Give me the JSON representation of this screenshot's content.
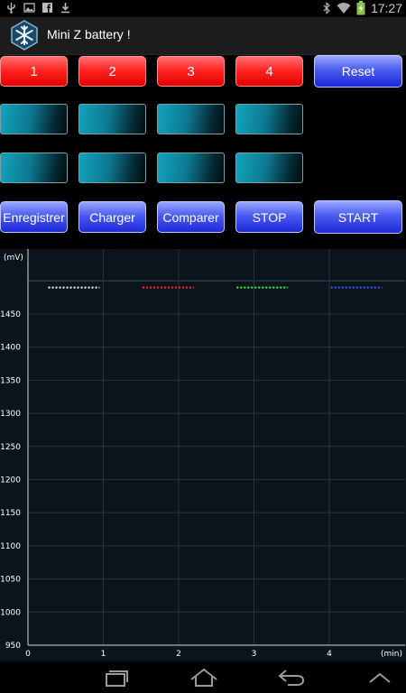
{
  "status_bar": {
    "time": "17:27",
    "left_icons": [
      "usb-icon",
      "image-icon",
      "facebook-icon",
      "download-icon"
    ],
    "right_icons": [
      "bluetooth-icon",
      "wifi-icon",
      "battery-charging-icon"
    ]
  },
  "app": {
    "title": "Mini Z battery !",
    "icon": "snowflake-icon"
  },
  "channel_buttons": [
    {
      "label": "1"
    },
    {
      "label": "2"
    },
    {
      "label": "3"
    },
    {
      "label": "4"
    }
  ],
  "reset_button": {
    "label": "Reset"
  },
  "actions": {
    "save_label": "Enregistrer",
    "load_label": "Charger",
    "compare_label": "Comparer",
    "stop_label": "STOP",
    "start_label": "START"
  },
  "colors": {
    "red_button": "#ff2020",
    "blue_button": "#2a36e0",
    "cell_cyan": "#13a3bf",
    "chart_bg": "#0b141c",
    "grid": "#24343c"
  },
  "chart_data": {
    "type": "line",
    "ylabel": "(mV)",
    "xlabel": "(min)",
    "xlim": [
      0,
      4.8
    ],
    "ylim": [
      950,
      1500
    ],
    "y_ticks": [
      950,
      1000,
      1050,
      1100,
      1150,
      1200,
      1250,
      1300,
      1350,
      1400,
      1450
    ],
    "x_ticks": [
      0,
      1,
      2,
      3,
      4
    ],
    "grid": true,
    "series": [
      {
        "color": "#ffffff",
        "x": [
          0.27,
          0.95
        ],
        "values": [
          1490,
          1490
        ]
      },
      {
        "color": "#ff3030",
        "x": [
          1.52,
          2.2
        ],
        "values": [
          1490,
          1490
        ]
      },
      {
        "color": "#40ff40",
        "x": [
          2.77,
          3.45
        ],
        "values": [
          1490,
          1490
        ]
      },
      {
        "color": "#4060ff",
        "x": [
          4.02,
          4.7
        ],
        "values": [
          1490,
          1490
        ]
      }
    ]
  },
  "nav_bar": {
    "icons": [
      "recent-apps-icon",
      "home-icon",
      "back-icon",
      "menu-up-icon"
    ]
  }
}
